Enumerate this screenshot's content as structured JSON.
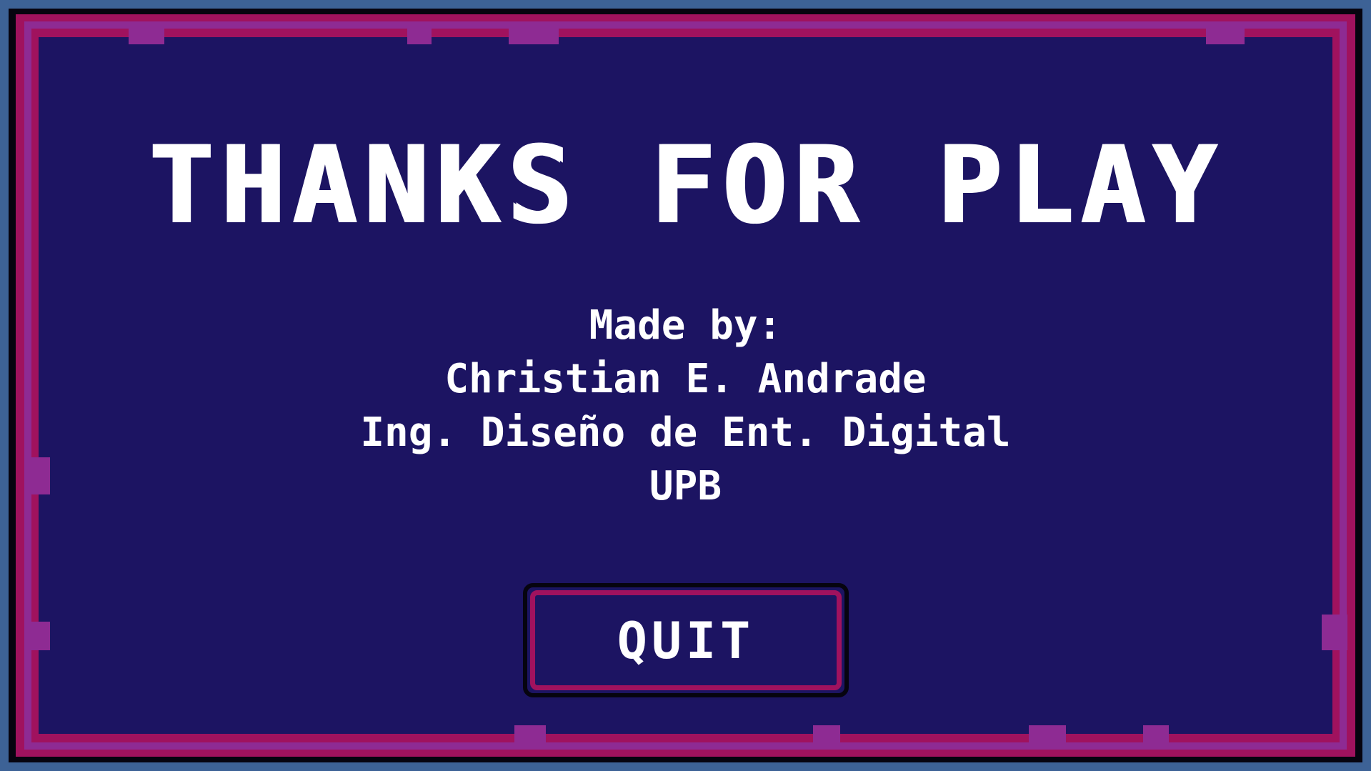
{
  "screen": {
    "title": "THANKS FOR PLAY",
    "credits": {
      "line1": "Made by:",
      "line2": "Christian E. Andrade",
      "line3": "Ing. Diseño de Ent. Digital",
      "line4": "UPB"
    },
    "quit_label": "QUIT"
  },
  "colors": {
    "background": "#3d6296",
    "panel": "#1c1462",
    "frame_magenta": "#a0125e",
    "frame_purple": "#8e2b93",
    "frame_outline": "#06040f",
    "text": "#ffffff"
  }
}
